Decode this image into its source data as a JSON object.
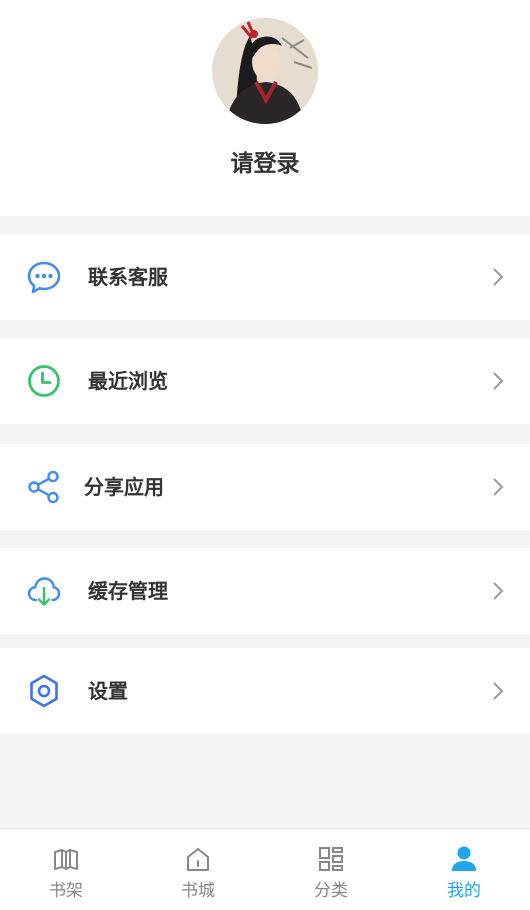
{
  "profile": {
    "login_prompt": "请登录"
  },
  "menu": {
    "items": [
      {
        "label": "联系客服",
        "icon": "chat-bubble-icon",
        "color": "#3d8ef0"
      },
      {
        "label": "最近浏览",
        "icon": "clock-icon",
        "color": "#34c46a"
      },
      {
        "label": "分享应用",
        "icon": "share-icon",
        "color": "#3d8ef0"
      },
      {
        "label": "缓存管理",
        "icon": "cloud-download-icon",
        "color": "#3d8ef0"
      },
      {
        "label": "设置",
        "icon": "gear-icon",
        "color": "#3d73f0"
      }
    ]
  },
  "tabbar": {
    "tabs": [
      {
        "label": "书架",
        "icon": "bookshelf-icon",
        "active": false
      },
      {
        "label": "书城",
        "icon": "home-icon",
        "active": false
      },
      {
        "label": "分类",
        "icon": "category-grid-icon",
        "active": false
      },
      {
        "label": "我的",
        "icon": "user-icon",
        "active": true
      }
    ],
    "active_color": "#1fa6ef",
    "inactive_color": "#888888"
  }
}
